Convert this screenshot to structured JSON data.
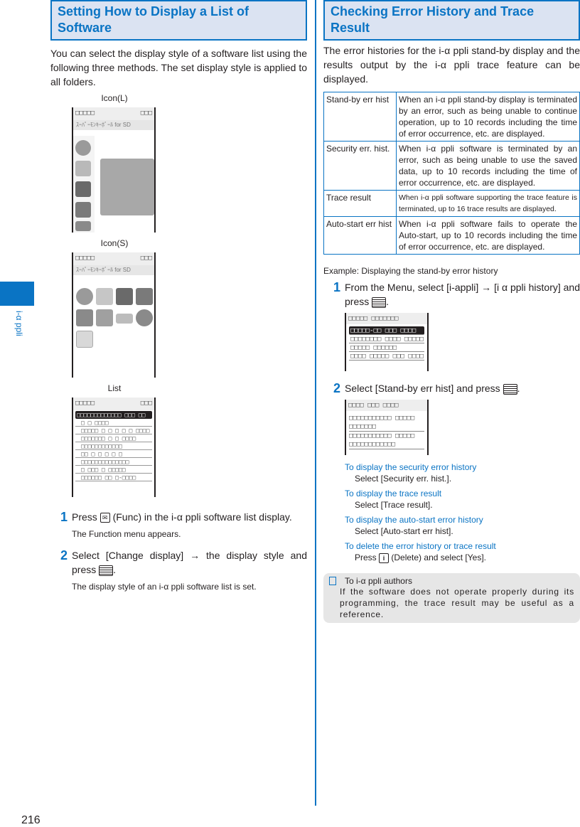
{
  "side_tab": {
    "label": "i-α ppli",
    "color": "#0a74c4"
  },
  "page_number": "216",
  "left": {
    "heading": "Setting How to Display a List of Software",
    "intro": "You can select the display style of a software list using the following three methods. The set display style is applied to all folders.",
    "screens": [
      {
        "caption": "Icon(L)",
        "status_left": "□□□□□",
        "status_right": "□□□",
        "subtitle": "ｽｰﾊﾟｰﾓﾝｷｰﾎﾞｰﾙ for SD"
      },
      {
        "caption": "Icon(S)",
        "status_left": "□□□□□",
        "status_right": "□□□",
        "subtitle": "ｽｰﾊﾟｰﾓﾝｷｰﾎﾞｰﾙ for SD"
      },
      {
        "caption": "List",
        "status_left": "□□□□□",
        "status_right": "□□□",
        "rows": [
          "□□□□□□□□□□□□□ □□□ □□",
          "□ □ □□□□",
          "□□□□□ □ □ □ □ □ □□□□",
          "□□□□□□□ □ □ □□□□",
          "□□□□□□□□□□□□",
          "□□ □ □ □ □ □",
          "□□□□□□□□□□□□□□",
          "□ □□□ □ □□□□□",
          "□□□□□□ □□ □-□□□□"
        ]
      }
    ],
    "steps": [
      {
        "num": "1",
        "text_before": "Press",
        "key": "mail-key",
        "text_after": "(Func) in the i-α ppli software list display.",
        "note": "The Function menu appears."
      },
      {
        "num": "2",
        "text_before": "Select [Change display] → the display style and press",
        "key": "menu-key",
        "text_after": ".",
        "note": "The display style of an i-α ppli software list is set."
      }
    ]
  },
  "right": {
    "heading": "Checking Error History and Trace Result",
    "intro": "The error histories for the i-α ppli stand-by display and the results output by the i-α ppli trace feature can be displayed.",
    "table": [
      {
        "key": "Stand-by err hist",
        "value": "When an i-α ppli stand-by display is terminated by an error, such as being unable to continue operation, up to 10 records including the time of error occurrence, etc. are displayed."
      },
      {
        "key": "Security err. hist.",
        "value": "When i-α ppli software is terminated by an error, such as being unable to use the saved data, up to 10 records including the time of error occurrence, etc. are displayed."
      },
      {
        "key": "Trace result",
        "value": "When i-α ppli software supporting the trace feature is terminated, up to 16 trace results are displayed."
      },
      {
        "key": "Auto-start err hist",
        "value": "When i-α ppli software fails to operate the Auto-start, up to 10 records including the time of error occurrence, etc. are displayed."
      }
    ],
    "example": "Example: Displaying the stand-by error history",
    "steps": [
      {
        "num": "1",
        "text_before": "From the Menu, select [i-appli] → [i α ppli history] and press",
        "text_after": "."
      },
      {
        "num": "2",
        "text_before": "Select [Stand-by err hist] and press",
        "text_after": "."
      }
    ],
    "screen1": {
      "title": "□□□□□ □□□□□□□",
      "rows": [
        "□□□□□-□□ □□□ □□□□",
        "□□□□□□□□ □□□□ □□□□□",
        "□□□□□ □□□□□□",
        "□□□□ □□□□□ □□□ □□□□"
      ]
    },
    "screen2": {
      "title": "□□□□ □□□ □□□□",
      "rows": [
        "□□□□□□□□□□□  □□□□□",
        "□□□□□□□",
        "□□□□□□□□□□□  □□□□□",
        "□□□□□□□□□□□□"
      ]
    },
    "options": [
      {
        "title": "To display the security error history",
        "body": "Select [Security err. hist.]."
      },
      {
        "title": "To display the trace result",
        "body": "Select [Trace result]."
      },
      {
        "title": "To display the auto-start error history",
        "body": "Select [Auto-start err hist]."
      },
      {
        "title": "To delete the error history or trace result",
        "body_before": "Press",
        "body_after": "(Delete) and select [Yes]."
      }
    ],
    "memo": {
      "title": "To i-α ppli authors",
      "body": "If the software does not operate properly during its programming, the trace result may be useful as a reference."
    }
  }
}
